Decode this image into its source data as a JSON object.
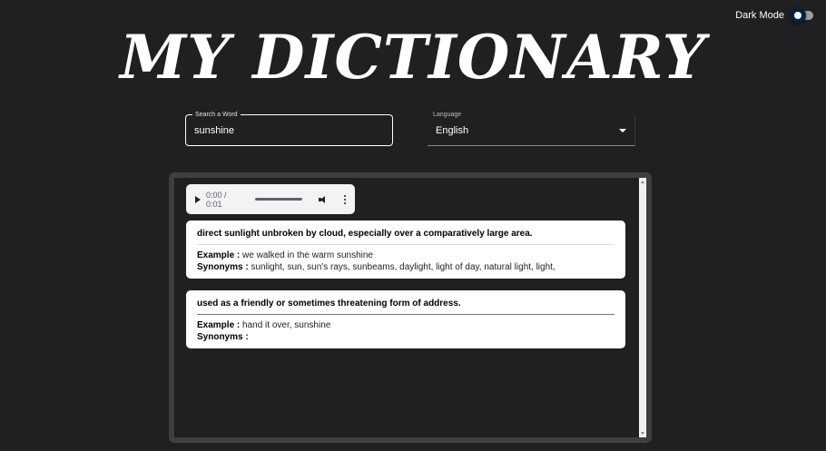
{
  "header": {
    "dark_mode_label": "Dark Mode",
    "title": "MY DICTIONARY"
  },
  "search": {
    "label": "Search a Word",
    "value": "sunshine"
  },
  "language": {
    "label": "Language",
    "value": "English"
  },
  "audio": {
    "time": "0:00 / 0:01"
  },
  "definitions": [
    {
      "definition": "direct sunlight unbroken by cloud, especially over a comparatively large area.",
      "example_label": "Example :",
      "example": "we walked in the warm sunshine",
      "synonyms_label": "Synonyms :",
      "synonyms": "sunlight, sun, sun's rays, sunbeams, daylight, light of day, natural light, light,"
    },
    {
      "definition": "used as a friendly or sometimes threatening form of address.",
      "example_label": "Example :",
      "example": "hand it over, sunshine",
      "synonyms_label": "Synonyms :",
      "synonyms": ""
    }
  ],
  "colors": {
    "background": "#202022",
    "panel_border": "#3f3f42",
    "card": "#ffffff",
    "toggle_knob": "#0b1e3c"
  },
  "icons": {
    "play": "play-icon",
    "volume": "volume-icon",
    "more": "more-vertical-icon",
    "select_caret": "chevron-down-icon"
  }
}
